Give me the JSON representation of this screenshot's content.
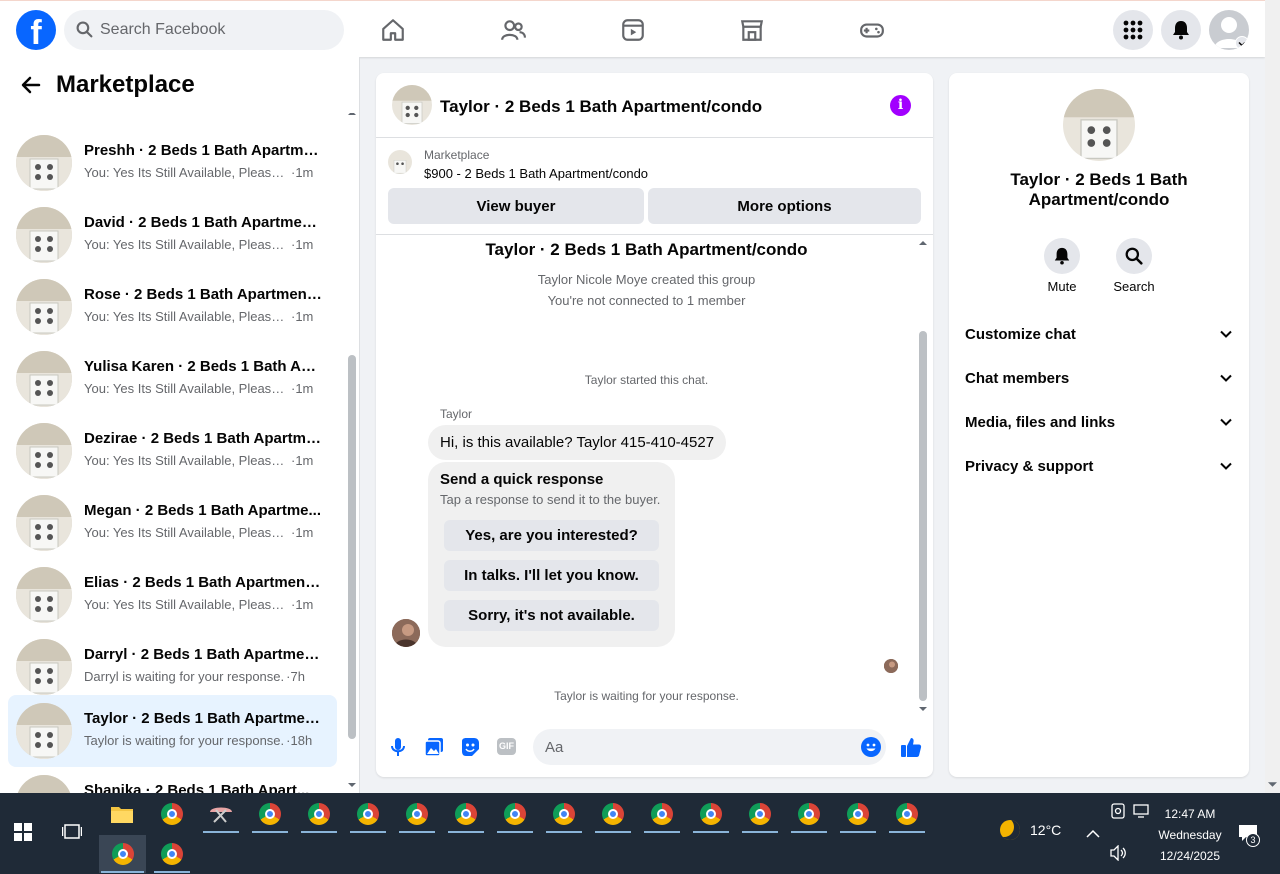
{
  "topbar": {
    "search_placeholder": "Search Facebook",
    "logo": "f"
  },
  "sidebar": {
    "title": "Marketplace",
    "conversations": [
      {
        "name": "Preshh · 2 Beds 1 Bath Apartmen...",
        "preview": "You: Yes Its Still Available, Please S...",
        "time": "·1m"
      },
      {
        "name": "David · 2 Beds 1 Bath Apartment...",
        "preview": "You: Yes Its Still Available, Please S...",
        "time": "·1m"
      },
      {
        "name": "Rose · 2 Beds 1 Bath Apartment/...",
        "preview": "You: Yes Its Still Available, Please S...",
        "time": "·1m"
      },
      {
        "name": "Yulisa Karen · 2 Beds 1 Bath Apa...",
        "preview": "You: Yes Its Still Available, Please S...",
        "time": "·1m"
      },
      {
        "name": "Dezirae · 2 Beds 1 Bath Apartme...",
        "preview": "You: Yes Its Still Available, Please S...",
        "time": "·1m"
      },
      {
        "name": "Megan · 2 Beds 1 Bath Apartme...",
        "preview": "You: Yes Its Still Available, Please S...",
        "time": "·1m"
      },
      {
        "name": "Elias · 2 Beds 1 Bath Apartment/...",
        "preview": "You: Yes Its Still Available, Please S...",
        "time": "·1m"
      },
      {
        "name": "Darryl · 2 Beds 1 Bath Apartmen...",
        "preview": "Darryl is waiting for your response.",
        "time": "·7h"
      },
      {
        "name": "Taylor · 2 Beds 1 Bath Apartment...",
        "preview": "Taylor is waiting for your response.",
        "time": "·18h"
      },
      {
        "name": "Shanika · 2 Beds 1 Bath Apart...",
        "preview": "",
        "time": ""
      }
    ]
  },
  "chat": {
    "title": "Taylor · 2 Beds 1 Bath Apartment/condo",
    "listing_source": "Marketplace",
    "listing_price": "$900 - 2 Beds 1 Bath Apartment/condo",
    "view_buyer": "View buyer",
    "more_options": "More options",
    "group_title": "Taylor · 2 Beds 1 Bath Apartment/condo",
    "created": "Taylor Nicole Moye created this group",
    "not_connected": "You're not connected to 1 member",
    "started": "Taylor started this chat.",
    "sender": "Taylor",
    "message": "Hi, is this available? Taylor 415-410-4527",
    "quick_title": "Send a quick response",
    "quick_sub": "Tap a response to send it to the buyer.",
    "quick_replies": [
      "Yes, are you interested?",
      "In talks. I'll let you know.",
      "Sorry, it's not available."
    ],
    "waiting": "Taylor is waiting for your response.",
    "input_placeholder": "Aa",
    "gif_label": "GIF"
  },
  "rpanel": {
    "title": "Taylor · 2 Beds 1 Bath Apartment/condo",
    "mute": "Mute",
    "search": "Search",
    "rows": [
      "Customize chat",
      "Chat members",
      "Media, files and links",
      "Privacy & support"
    ]
  },
  "taskbar": {
    "temperature": "12°C",
    "time": "12:47 AM",
    "day": "Wednesday",
    "date": "12/24/2025",
    "notifications": "3"
  }
}
